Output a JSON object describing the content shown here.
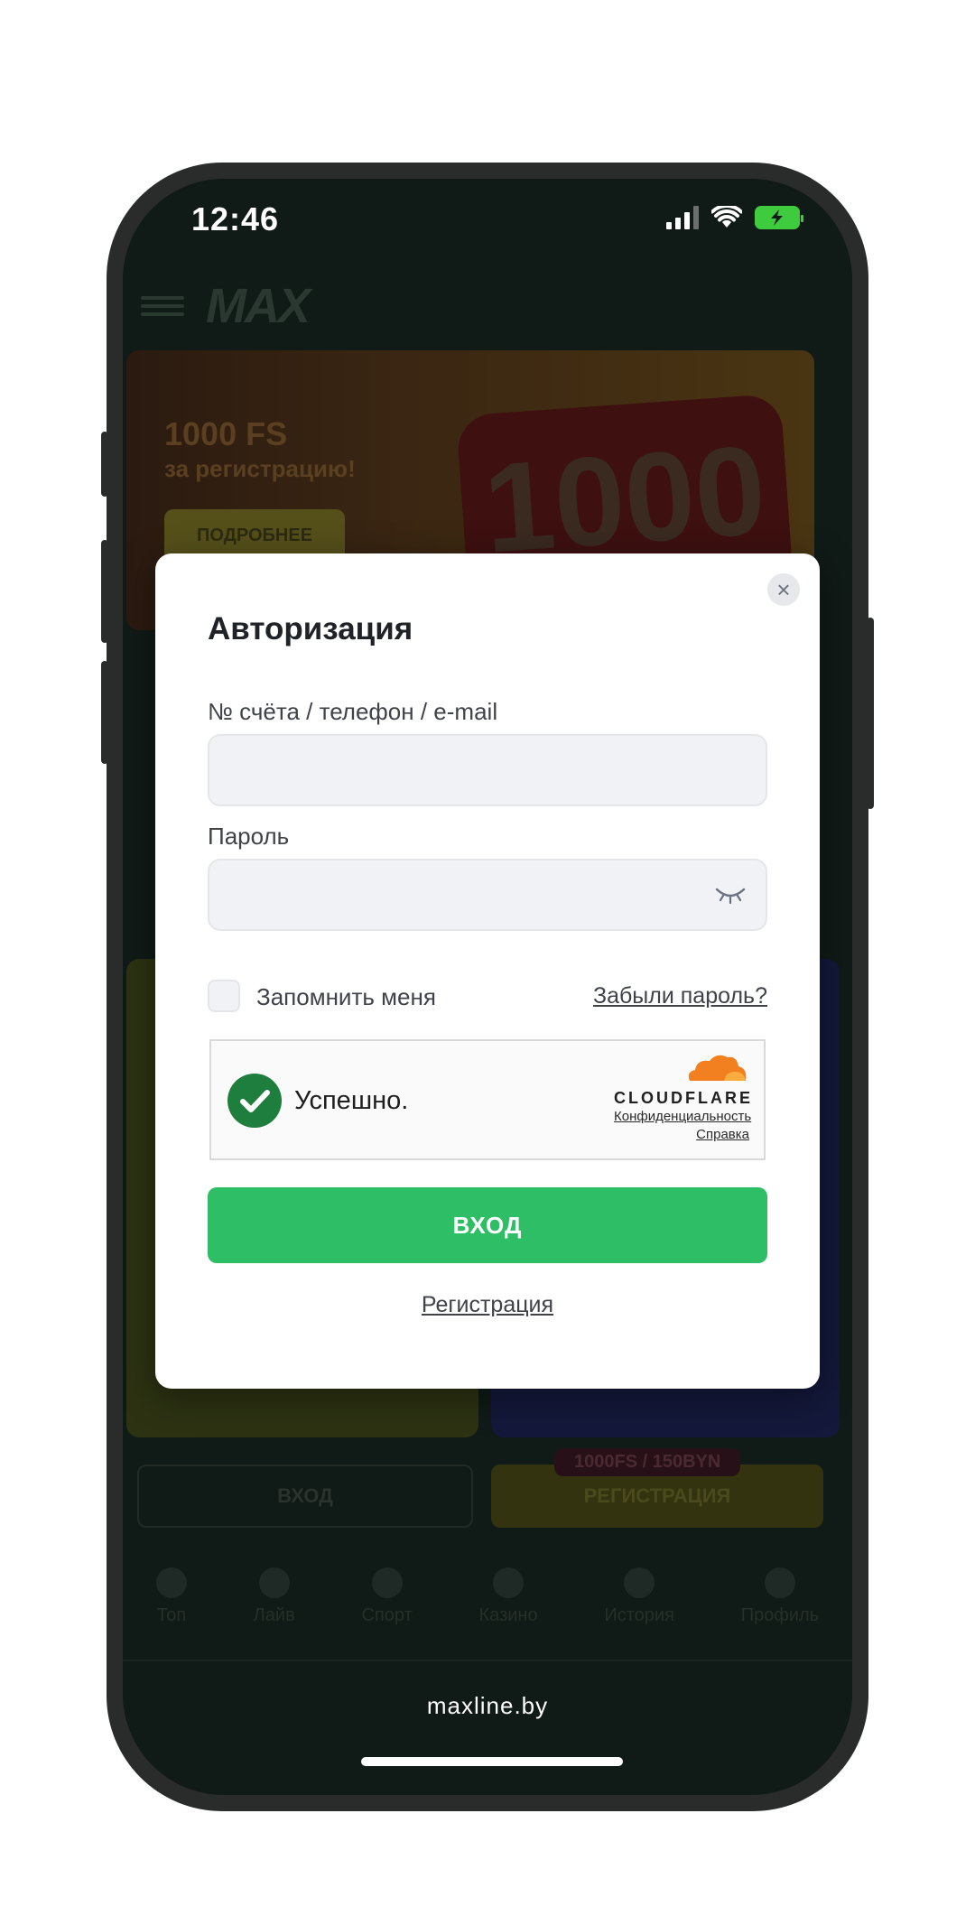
{
  "status_bar": {
    "time": "12:46"
  },
  "background_app": {
    "logo": "MAX",
    "banner": {
      "title": "1000 FS",
      "subtitle": "за регистрацию!",
      "button": "ПОДРОБНЕЕ",
      "big_number": "1000"
    },
    "actions": {
      "login": "ВХОД",
      "register": "РЕГИСТРАЦИЯ",
      "register_badge": "1000FS / 150BYN"
    },
    "tabs": [
      "Топ",
      "Лайв",
      "Спорт",
      "Казино",
      "История",
      "Профиль"
    ]
  },
  "modal": {
    "title": "Авторизация",
    "account_label": "№ счёта / телефон / e-mail",
    "account_value": "",
    "password_label": "Пароль",
    "password_value": "",
    "remember_label": "Запомнить меня",
    "remember_checked": false,
    "forgot_link": "Забыли пароль?",
    "turnstile": {
      "status_text": "Успешно.",
      "brand": "CLOUDFLARE",
      "privacy_link": "Конфиденциальность",
      "help_link": "Справка"
    },
    "login_button": "ВХОД",
    "register_link": "Регистрация"
  },
  "browser": {
    "domain": "maxline.by"
  },
  "colors": {
    "accent_green": "#2ebe66",
    "cloudflare_orange": "#f38020",
    "battery_green": "#3ecb3e"
  },
  "icons": [
    "close-icon",
    "eye-closed-icon",
    "check-icon",
    "cloudflare-logo",
    "signal-icon",
    "wifi-icon",
    "battery-charging-icon"
  ]
}
